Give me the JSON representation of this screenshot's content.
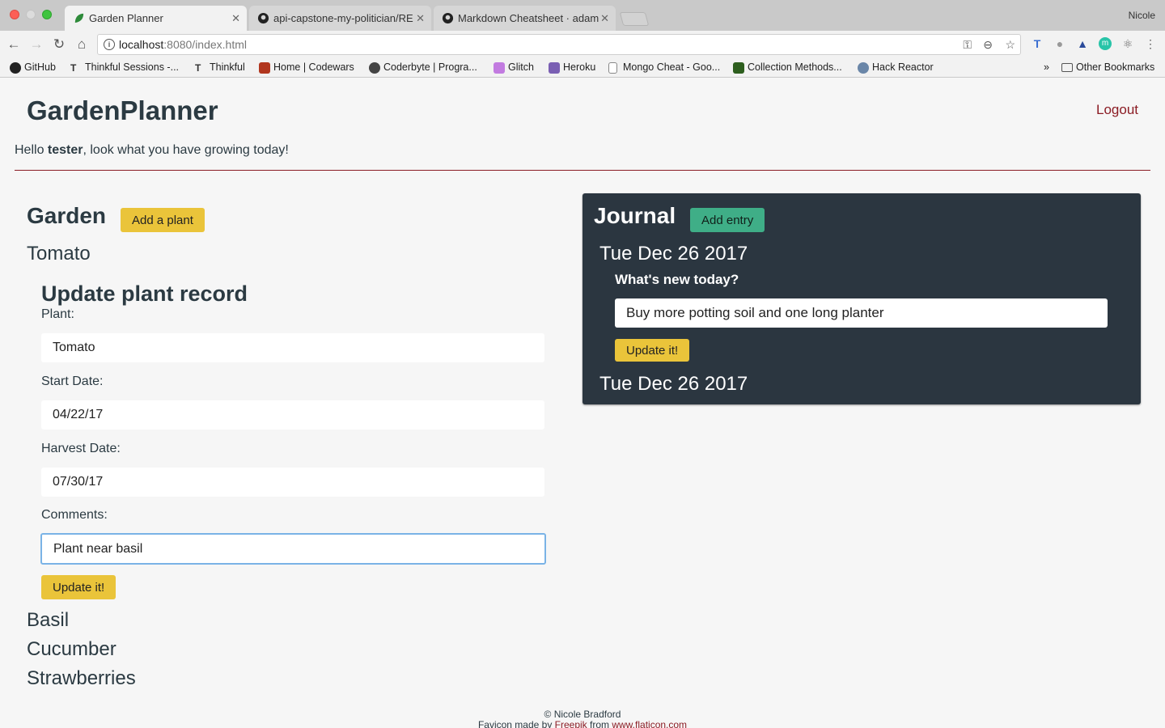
{
  "browser": {
    "tabs": [
      {
        "title": "Garden Planner",
        "close": "✕"
      },
      {
        "title": "api-capstone-my-politician/RE",
        "close": "✕"
      },
      {
        "title": "Markdown Cheatsheet · adam",
        "close": "✕"
      }
    ],
    "profile_name": "Nicole",
    "url_host": "localhost",
    "url_rest": ":8080/index.html",
    "bookmarks": [
      "GitHub",
      "Thinkful Sessions -...",
      "Thinkful",
      "Home | Codewars",
      "Coderbyte | Progra...",
      "Glitch",
      "Heroku",
      "Mongo Cheat - Goo...",
      "Collection Methods...",
      "Hack Reactor"
    ],
    "other_bookmarks": "Other Bookmarks",
    "overflow": "»"
  },
  "app": {
    "title": "GardenPlanner",
    "logout": "Logout",
    "greeting_prefix": "Hello ",
    "username": "tester",
    "greeting_suffix": ", look what you have growing today!"
  },
  "garden": {
    "heading": "Garden",
    "add_button": "Add a plant",
    "plants": [
      "Tomato",
      "Basil",
      "Cucumber",
      "Strawberries"
    ],
    "update_form": {
      "heading": "Update plant record",
      "plant_label": "Plant:",
      "plant_value": "Tomato",
      "start_label": "Start Date:",
      "start_value": "04/22/17",
      "harvest_label": "Harvest Date:",
      "harvest_value": "07/30/17",
      "comments_label": "Comments:",
      "comments_value": "Plant near basil",
      "submit": "Update it!"
    }
  },
  "journal": {
    "heading": "Journal",
    "add_button": "Add entry",
    "entries": [
      {
        "date": "Tue Dec 26 2017",
        "question": "What's new today?",
        "value": "Buy more potting soil and one long planter",
        "submit": "Update it!"
      },
      {
        "date": "Tue Dec 26 2017"
      }
    ]
  },
  "footer": {
    "copyright": "© Nicole Bradford",
    "favicon_prefix": "Favicon made by ",
    "favicon_author": "Freepik",
    "favicon_middle": " from ",
    "favicon_site": "www.flaticon.com"
  },
  "colors": {
    "accent_red": "#8b1c24",
    "button_yellow": "#eac43a",
    "button_green": "#3fae87",
    "journal_bg": "#2b3640",
    "text_dark": "#2b3a42"
  }
}
